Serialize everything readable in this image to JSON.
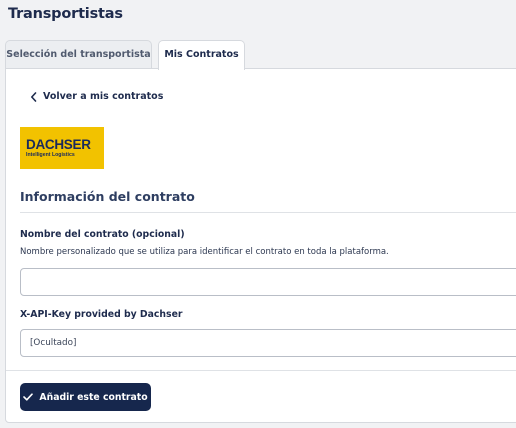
{
  "header": {
    "title": "Transportistas"
  },
  "tabs": [
    {
      "label": "Selección del transportista",
      "active": false
    },
    {
      "label": "Mis Contratos",
      "active": true
    }
  ],
  "main": {
    "back_link": "Volver a mis contratos",
    "carrier_logo": {
      "name": "DACHSER",
      "tagline": "Intelligent Logistics",
      "color": "#f2c200"
    },
    "section_title": "Información del contrato",
    "contract_name": {
      "label": "Nombre del contrato (opcional)",
      "help": "Nombre personalizado que se utiliza para identificar el contrato en toda la plataforma.",
      "value": ""
    },
    "api_key": {
      "label": "X-API-Key provided by Dachser",
      "placeholder": "[Ocultado]"
    },
    "submit_label": "Añadir este contrato"
  },
  "colors": {
    "primary": "#16274d",
    "background": "#f1f2f4",
    "logo_yellow": "#f2c200"
  }
}
